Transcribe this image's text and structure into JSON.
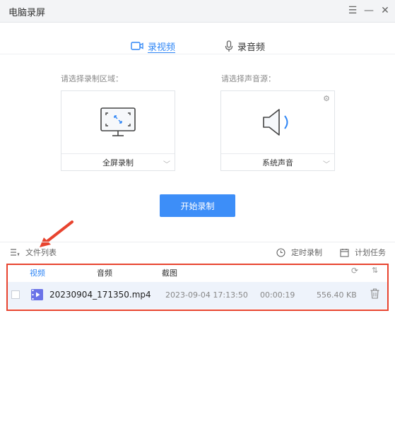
{
  "window": {
    "title": "电脑录屏"
  },
  "tabs": [
    {
      "label": "录视频",
      "active": true
    },
    {
      "label": "录音频",
      "active": false
    }
  ],
  "record_area": {
    "label": "请选择录制区域：",
    "value": "全屏录制"
  },
  "sound_source": {
    "label": "请选择声音源：",
    "value": "系统声音"
  },
  "start_button": {
    "label": "开始录制"
  },
  "list_toolbar": {
    "file_list_label": "文件列表",
    "timer_label": "定时录制",
    "plan_label": "计划任务"
  },
  "file_tabs": [
    {
      "label": "视频",
      "active": true
    },
    {
      "label": "音频",
      "active": false
    },
    {
      "label": "截图",
      "active": false
    }
  ],
  "files": [
    {
      "name": "20230904_171350.mp4",
      "date": "2023-09-04 17:13:50",
      "duration": "00:00:19",
      "size": "556.40 KB"
    }
  ],
  "colors": {
    "accent": "#2f86f6",
    "button": "#3d8ef8",
    "highlight": "#e8442f"
  },
  "icons": [
    "menu-icon",
    "minimize-icon",
    "close-icon",
    "camera-icon",
    "microphone-icon",
    "monitor-fullscreen-icon",
    "speaker-icon",
    "gear-icon",
    "chevron-down-icon",
    "list-icon",
    "clock-icon",
    "calendar-icon",
    "refresh-icon",
    "sort-icon",
    "video-file-icon",
    "trash-icon"
  ]
}
